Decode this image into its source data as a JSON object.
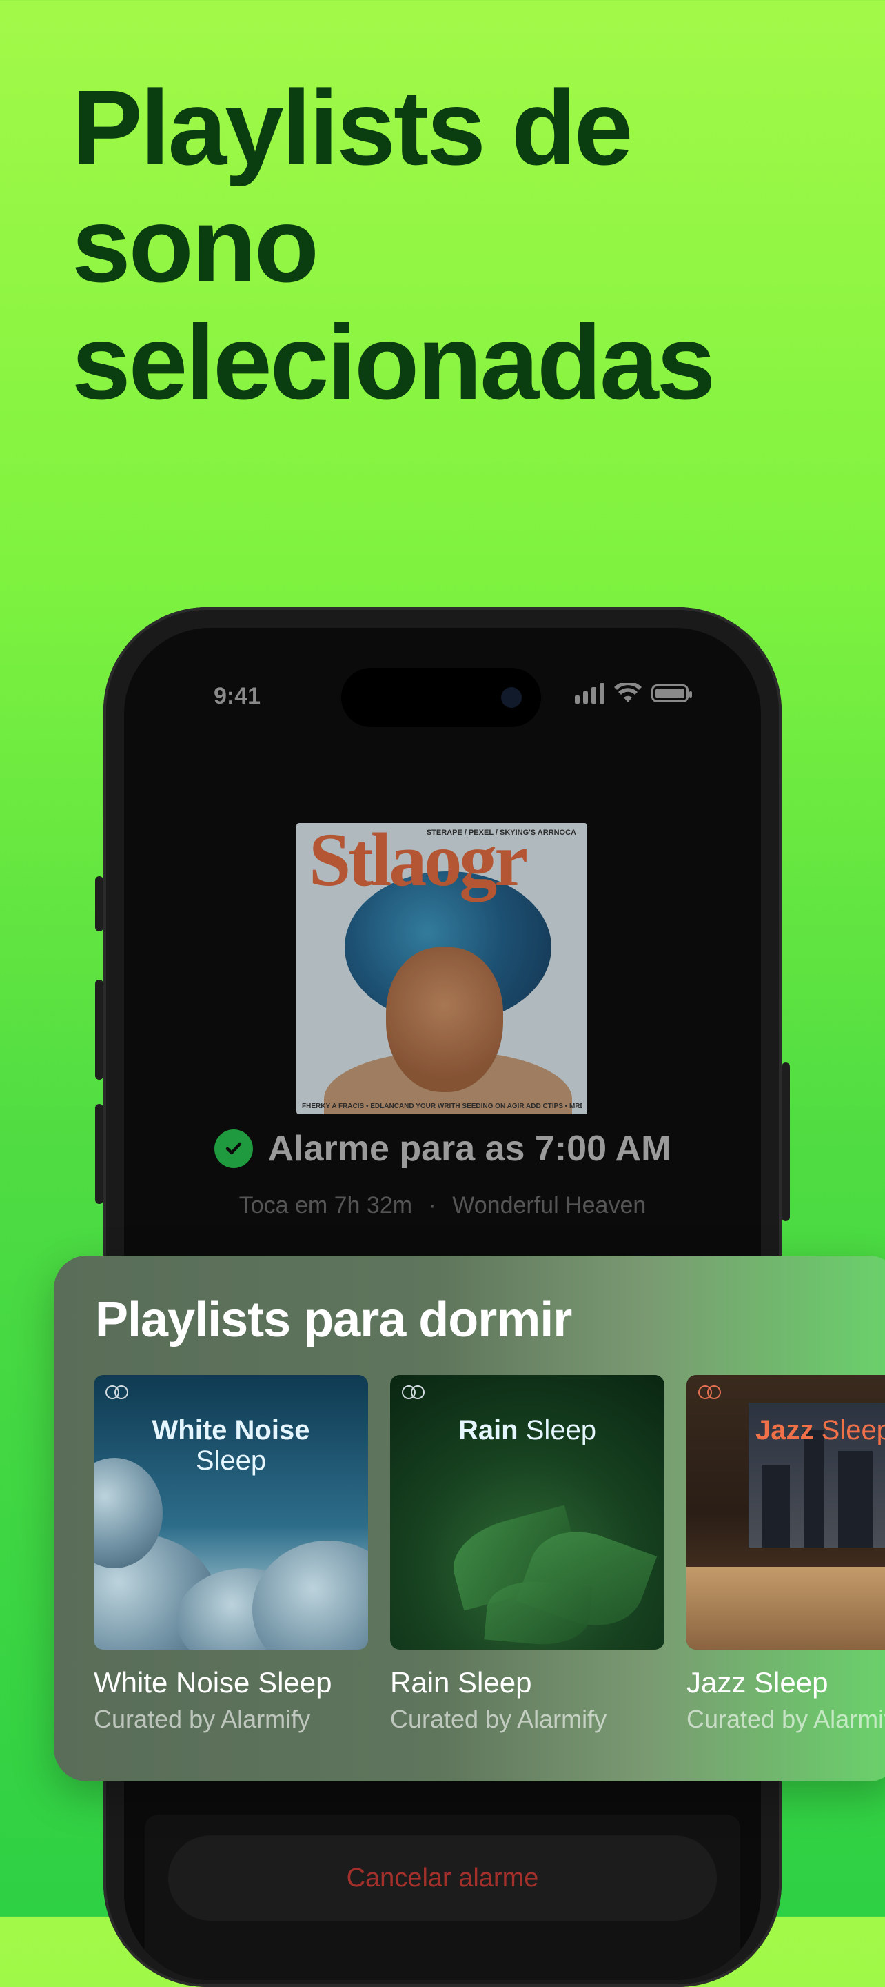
{
  "headline": {
    "line1": "Playlists de",
    "line2": "sono",
    "line3": "selecionadas"
  },
  "status_bar": {
    "time": "9:41"
  },
  "now_playing": {
    "cover_title": "Stlaogr",
    "cover_top_text": "STERAPE / PEXEL / SKYING'S ARRNOCA",
    "cover_bottom_text": "FHERKY A FRACIS • EDLANCAND YOUR WRITH SEEDING ON AGIR ADD CTIPS • MRDFALE NAPPLAPORINS."
  },
  "alarm": {
    "label": "Alarme para as 7:00 AM",
    "countdown": "Toca em 7h 32m",
    "separator": "·",
    "sound": "Wonderful Heaven"
  },
  "cancel_button": {
    "label": "Cancelar alarme"
  },
  "playlists_card": {
    "title": "Playlists para dormir",
    "items": [
      {
        "art_bold": "White Noise",
        "art_light": "Sleep",
        "name": "White Noise Sleep",
        "curator": "Curated by Alarmify"
      },
      {
        "art_bold": "Rain",
        "art_light": "Sleep",
        "name": "Rain Sleep",
        "curator": "Curated by Alarmify"
      },
      {
        "art_bold": "Jazz",
        "art_light": "Sleep",
        "name": "Jazz Sleep",
        "curator": "Curated by Alarmify"
      }
    ]
  },
  "colors": {
    "background_top": "#a3f948",
    "background_bottom": "#2ed044",
    "headline": "#0a3d10",
    "check": "#1f9a3e",
    "cancel_text": "#a3302a"
  },
  "icons": [
    "signal-icon",
    "wifi-icon",
    "battery-icon",
    "check-icon",
    "alarmify-logo-icon"
  ]
}
